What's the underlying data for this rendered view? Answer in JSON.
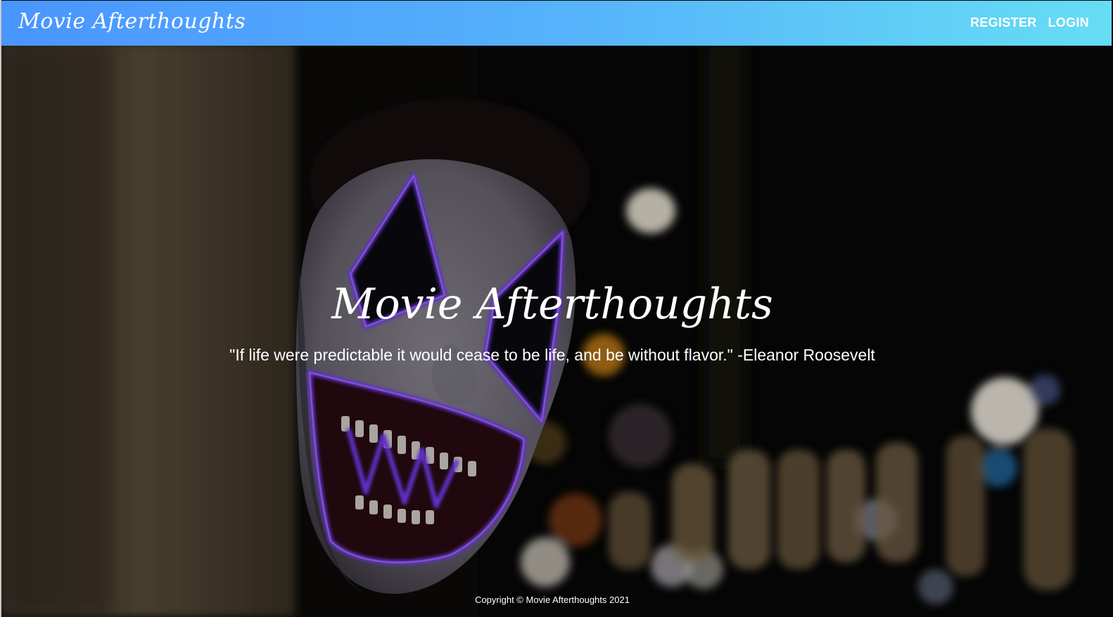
{
  "navbar": {
    "brand": "Movie Afterthoughts",
    "links": [
      "REGISTER",
      "LOGIN"
    ],
    "gradient_start": "#4a95ff",
    "gradient_end": "#66ddf4"
  },
  "hero": {
    "title": "Movie Afterthoughts",
    "quote": "\"If life were predictable it would cease to be life, and be without flavor.\" -Eleanor Roosevelt",
    "background_image": "clown-mask-neon-bokeh"
  },
  "footer": {
    "copyright": "Copyright © Movie Afterthoughts 2021"
  }
}
